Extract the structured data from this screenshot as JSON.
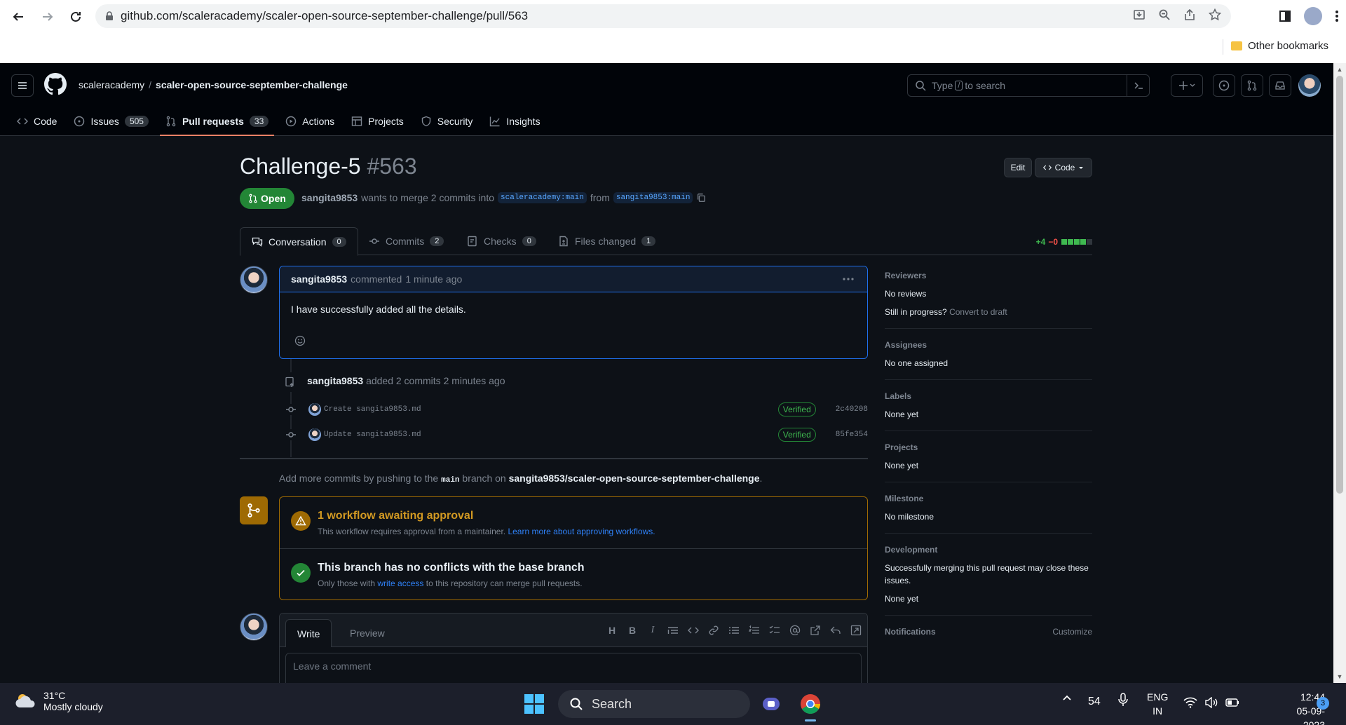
{
  "browser": {
    "url": "github.com/scaleracademy/scaler-open-source-september-challenge/pull/563",
    "bookmark_folder": "Other bookmarks"
  },
  "repo": {
    "owner": "scaleracademy",
    "name": "scaler-open-source-september-challenge",
    "search_placeholder_pre": "Type",
    "search_placeholder_key": "/",
    "search_placeholder_post": "to search"
  },
  "repo_nav": [
    {
      "label": "Code",
      "icon": "code-icon"
    },
    {
      "label": "Issues",
      "icon": "issue-icon",
      "count": "505"
    },
    {
      "label": "Pull requests",
      "icon": "pull-request-icon",
      "count": "33",
      "active": true
    },
    {
      "label": "Actions",
      "icon": "play-icon"
    },
    {
      "label": "Projects",
      "icon": "table-icon"
    },
    {
      "label": "Security",
      "icon": "shield-icon"
    },
    {
      "label": "Insights",
      "icon": "graph-icon"
    }
  ],
  "pr": {
    "title": "Challenge-5",
    "number": "#563",
    "edit_label": "Edit",
    "code_label": "Code",
    "state": "Open",
    "author": "sangita9853",
    "merge_text": "wants to merge 2 commits into",
    "base_branch": "scaleracademy:main",
    "from_text": "from",
    "head_branch": "sangita9853:main"
  },
  "tabs": [
    {
      "label": "Conversation",
      "count": "0"
    },
    {
      "label": "Commits",
      "count": "2"
    },
    {
      "label": "Checks",
      "count": "0"
    },
    {
      "label": "Files changed",
      "count": "1"
    }
  ],
  "diffstat": {
    "additions": "+4",
    "deletions": "−0",
    "added_color": "#3fb950"
  },
  "comment": {
    "author": "sangita9853",
    "action": "commented",
    "time": "1 minute ago",
    "body": "I have successfully added all the details."
  },
  "commits_event": {
    "author": "sangita9853",
    "text": "added 2 commits",
    "time": "2 minutes ago"
  },
  "commits": [
    {
      "message": "Create sangita9853.md",
      "badge": "Verified",
      "sha": "2c40208"
    },
    {
      "message": "Update sangita9853.md",
      "badge": "Verified",
      "sha": "85fe354"
    }
  ],
  "push_hint": {
    "pre": "Add more commits by pushing to the",
    "branch": "main",
    "mid": "branch on",
    "repo": "sangita9853/scaler-open-source-september-challenge",
    "post": "."
  },
  "merge": {
    "workflow_title": "1 workflow awaiting approval",
    "workflow_sub": "This workflow requires approval from a maintainer.",
    "workflow_link": "Learn more about approving workflows.",
    "conflicts_title": "This branch has no conflicts with the base branch",
    "conflicts_sub_pre": "Only those with",
    "conflicts_link": "write access",
    "conflicts_sub_post": "to this repository can merge pull requests.",
    "warning_color": "#d29922",
    "success_color": "#238636"
  },
  "composer": {
    "write_tab": "Write",
    "preview_tab": "Preview",
    "placeholder": "Leave a comment"
  },
  "sidebar": {
    "reviewers": {
      "heading": "Reviewers",
      "value": "No reviews",
      "draft_pre": "Still in progress?",
      "draft_link": "Convert to draft"
    },
    "assignees": {
      "heading": "Assignees",
      "value": "No one assigned"
    },
    "labels": {
      "heading": "Labels",
      "value": "None yet"
    },
    "projects": {
      "heading": "Projects",
      "value": "None yet"
    },
    "milestone": {
      "heading": "Milestone",
      "value": "No milestone"
    },
    "development": {
      "heading": "Development",
      "text": "Successfully merging this pull request may close these issues.",
      "value": "None yet"
    },
    "notifications": {
      "heading": "Notifications",
      "customize": "Customize"
    }
  },
  "taskbar": {
    "temperature": "31°C",
    "condition": "Mostly cloudy",
    "search_label": "Search",
    "battery_level": "54",
    "lang_top": "ENG",
    "lang_bottom": "IN",
    "time": "12:44",
    "date": "05-09-2023",
    "notifications": "3"
  }
}
